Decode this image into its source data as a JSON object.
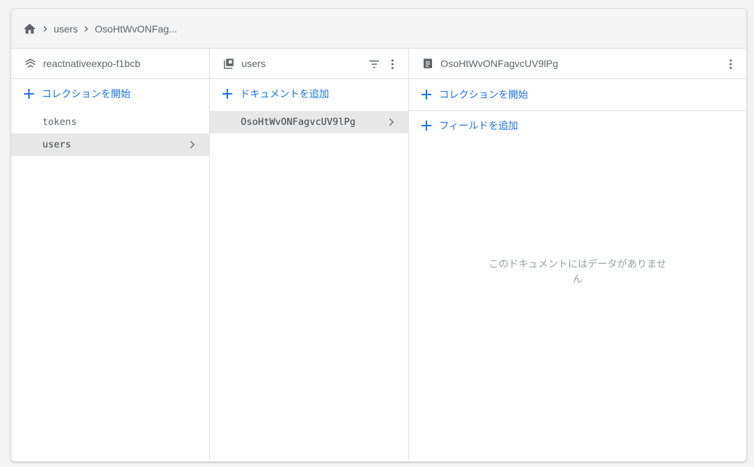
{
  "breadcrumb": {
    "home_icon": "home-icon",
    "items": [
      "users",
      "OsoHtWvONFag..."
    ]
  },
  "columns": {
    "project": {
      "icon": "firestore-layers-icon",
      "title": "reactnativeexpo-f1bcb",
      "action_label": "コレクションを開始",
      "items": [
        "tokens",
        "users"
      ],
      "selected_item": "users"
    },
    "collection": {
      "icon": "collection-icon",
      "title": "users",
      "action_label": "ドキュメントを追加",
      "items": [
        "OsoHtWvONFagvcUV9lPg"
      ],
      "selected_item": "OsoHtWvONFagvcUV9lPg"
    },
    "document": {
      "icon": "document-icon",
      "title": "OsoHtWvONFagvcUV9lPg",
      "start_collection_label": "コレクションを開始",
      "add_field_label": "フィールドを追加",
      "empty_message": "このドキュメントにはデータがありません"
    }
  },
  "colors": {
    "accent": "#1a73e8",
    "muted_text": "#5f6368",
    "selected_bg": "#e8e8e8",
    "border": "#e0e0e0"
  }
}
